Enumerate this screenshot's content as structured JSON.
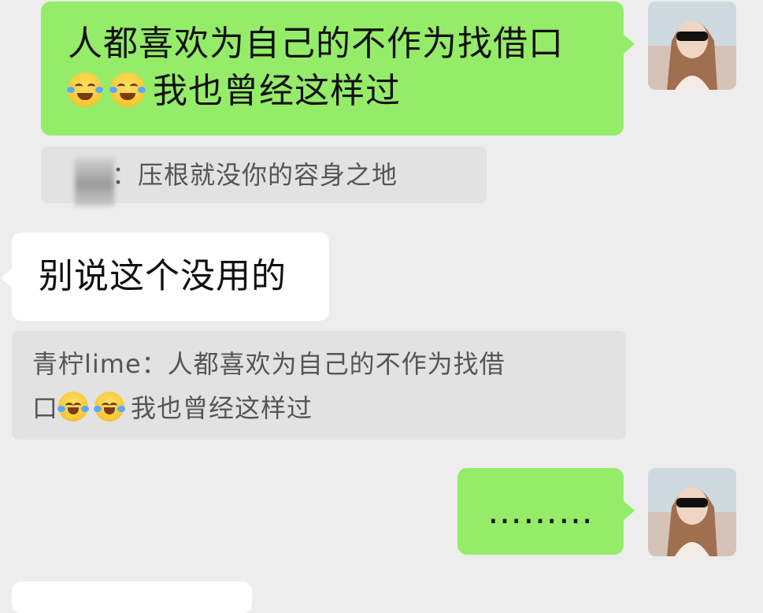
{
  "messages": {
    "m1": {
      "line1": "人都喜欢为自己的不作为找借口",
      "line2": "我也曾经这样过",
      "emoji": "face-with-tears-of-joy"
    },
    "quote1": {
      "sender": "：",
      "text": "压根就没你的容身之地"
    },
    "m2": {
      "text": "别说这个没用的"
    },
    "quote2": {
      "sender": "青柠lime：",
      "line1": "人都喜欢为自己的不作为找借",
      "line2_prefix": "口",
      "line2_text": "我也曾经这样过",
      "emoji": "face-with-tears-of-joy"
    },
    "m3": {
      "text": "………"
    }
  },
  "colors": {
    "background": "#ededed",
    "outgoing_bubble": "#95ec69",
    "incoming_bubble": "#ffffff",
    "quote_bg": "#e2e2e2"
  },
  "icons": {
    "avatar": "user-avatar-photo",
    "emoji": "face-with-tears-of-joy-icon"
  }
}
